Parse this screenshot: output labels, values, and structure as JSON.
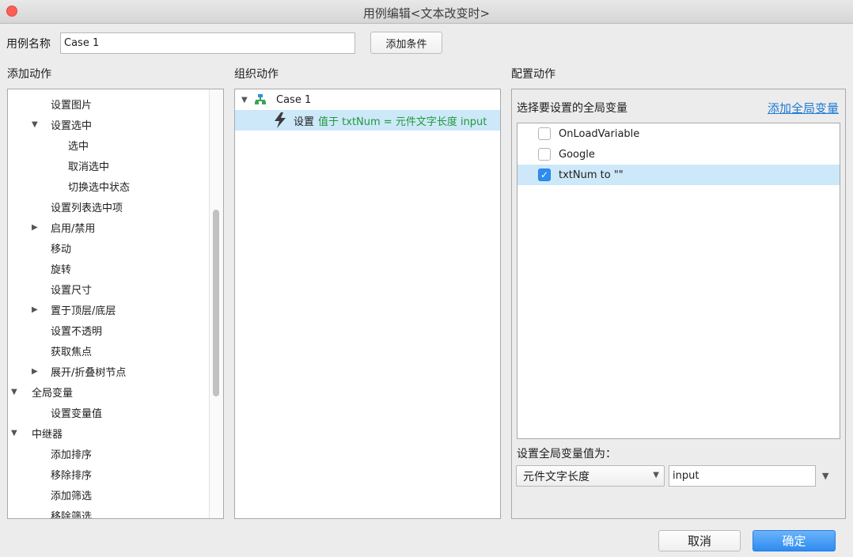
{
  "window": {
    "title": "用例编辑<文本改变时>"
  },
  "case_name": {
    "label": "用例名称",
    "value": "Case 1"
  },
  "add_condition_label": "添加条件",
  "left_panel": {
    "header": "添加动作",
    "items": [
      {
        "label": "设置图片",
        "indent": 2,
        "arrow": ""
      },
      {
        "label": "设置选中",
        "indent": 2,
        "arrow": "down"
      },
      {
        "label": "选中",
        "indent": 3,
        "arrow": ""
      },
      {
        "label": "取消选中",
        "indent": 3,
        "arrow": ""
      },
      {
        "label": "切换选中状态",
        "indent": 3,
        "arrow": ""
      },
      {
        "label": "设置列表选中项",
        "indent": 2,
        "arrow": ""
      },
      {
        "label": "启用/禁用",
        "indent": 2,
        "arrow": "right"
      },
      {
        "label": "移动",
        "indent": 2,
        "arrow": ""
      },
      {
        "label": "旋转",
        "indent": 2,
        "arrow": ""
      },
      {
        "label": "设置尺寸",
        "indent": 2,
        "arrow": ""
      },
      {
        "label": "置于顶层/底层",
        "indent": 2,
        "arrow": "right"
      },
      {
        "label": "设置不透明",
        "indent": 2,
        "arrow": ""
      },
      {
        "label": "获取焦点",
        "indent": 2,
        "arrow": ""
      },
      {
        "label": "展开/折叠树节点",
        "indent": 2,
        "arrow": "right"
      },
      {
        "label": "全局变量",
        "indent": 1,
        "arrow": "down"
      },
      {
        "label": "设置变量值",
        "indent": 2,
        "arrow": ""
      },
      {
        "label": "中继器",
        "indent": 1,
        "arrow": "down"
      },
      {
        "label": "添加排序",
        "indent": 2,
        "arrow": ""
      },
      {
        "label": "移除排序",
        "indent": 2,
        "arrow": ""
      },
      {
        "label": "添加筛选",
        "indent": 2,
        "arrow": ""
      },
      {
        "label": "移除筛选",
        "indent": 2,
        "arrow": ""
      }
    ]
  },
  "middle_panel": {
    "header": "组织动作",
    "case_label": "Case 1",
    "action_prefix": "设置",
    "action_detail": "值于 txtNum = 元件文字长度 input"
  },
  "right_panel": {
    "header": "配置动作",
    "select_label": "选择要设置的全局变量",
    "add_global_link": "添加全局变量",
    "variables": [
      {
        "label": "OnLoadVariable",
        "checked": false
      },
      {
        "label": "Google",
        "checked": false
      },
      {
        "label": "txtNum to \"\"",
        "checked": true
      }
    ],
    "set_value_label": "设置全局变量值为：",
    "value_type": "元件文字长度",
    "value_target": "input"
  },
  "footer": {
    "cancel_label": "取消",
    "ok_label": "确定"
  },
  "colors": {
    "accent": "#2d8cf0",
    "selection": "#cde8f9",
    "link": "#1e7ad6",
    "close": "#fc5f57"
  },
  "icons": [
    "close-dot-icon",
    "case-tree-icon",
    "lightning-icon",
    "check-icon",
    "chevron-down-icon"
  ]
}
